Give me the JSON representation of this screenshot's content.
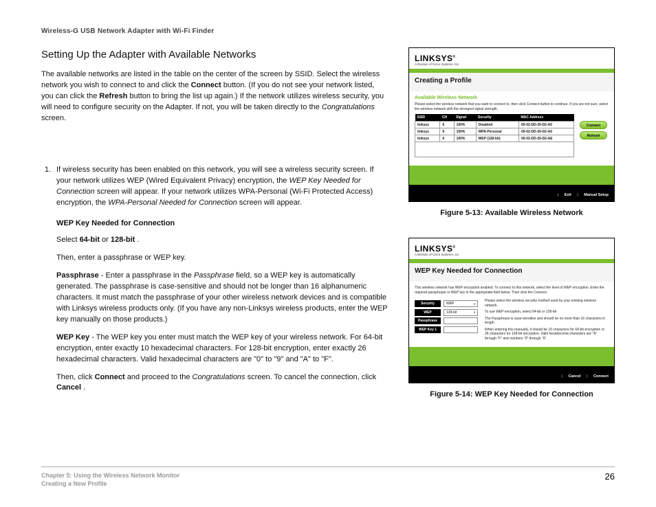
{
  "header": "Wireless-G USB Network Adapter with Wi-Fi Finder",
  "title": "Setting Up the Adapter with Available Networks",
  "intro": {
    "seg1": "The available networks are listed in the table on the center of the screen by SSID. Select the wireless network you wish to connect to and click the ",
    "btn_connect": "Connect",
    "seg2": " button. (If you do not see your network listed, you can click the ",
    "btn_refresh": "Refresh",
    "seg3": " button to bring the list up again.) If the network utilizes wireless security, you will need to configure security on the Adapter. If not, you will be taken directly to the ",
    "ital_congrats": "Congratulations",
    "seg4": " screen."
  },
  "li1": {
    "num": "1.",
    "a": "If wireless security has been enabled on this network, you will see a wireless security screen. If your network utilizes WEP (Wired Equivalent Privacy) encryption, the ",
    "b_ital": "WEP Key Needed for Connection",
    "c": " screen will appear. If your network utilizes WPA-Personal (Wi-Fi Protected Access) encryption, the ",
    "d_ital": "WPA-Personal Needed for Connection",
    "e": " screen will appear."
  },
  "wep_heading": "WEP Key Needed for Connection",
  "select_line": {
    "a": "Select ",
    "b64": "64-bit",
    "c": " or ",
    "b128": "128-bit",
    "d": "."
  },
  "then_enter": "Then, enter a passphrase or WEP key.",
  "passphrase": {
    "label": "Passphrase",
    "a": " - Enter a passphrase in the ",
    "field": "Passphrase",
    "b": " field, so a WEP key is automatically generated. The passphrase is case-sensitive and should not be longer than 16 alphanumeric characters. It must match the passphrase of your other wireless network devices and is compatible with Linksys wireless products only. (If you have any non-Linksys wireless products, enter the WEP key manually on those products.)"
  },
  "wepkey": {
    "label": "WEP Key",
    "a": " - The WEP key you enter must match the WEP key of your wireless network. For 64-bit encryption, enter exactly 10 hexadecimal characters. For 128-bit encryption, enter exactly 26 hexadecimal characters. Valid hexadecimal characters are \"0\" to \"9\" and \"A\" to \"F\"."
  },
  "closing": {
    "a": "Then, click ",
    "connect": "Connect",
    "b": " and proceed to the ",
    "congrats": "Congratulations",
    "c": " screen. To cancel the connection, click ",
    "cancel": "Cancel",
    "d": "."
  },
  "fig1": {
    "logo": "LINKSYS",
    "sub": "A Division of Cisco Systems, Inc.",
    "panel_title": "Creating a Profile",
    "section_title": "Available Wireless Network",
    "desc": "Please select the wireless network that you want to connect to, then click Connect button to continue. If you are not sure, select the wireless network with the strongest signal strength.",
    "th": {
      "ssid": "SSID",
      "ch": "CH",
      "signal": "Signal",
      "security": "Security",
      "mac": "MAC Address"
    },
    "rows": [
      {
        "ssid": "linksys",
        "ch": "6",
        "signal": "100%",
        "security": "Disabled",
        "mac": "00-02-DD-30-D2-A0"
      },
      {
        "ssid": "linksys",
        "ch": "6",
        "signal": "100%",
        "security": "WPA-Personal",
        "mac": "00-02-DD-30-D2-A0"
      },
      {
        "ssid": "linksys",
        "ch": "6",
        "signal": "100%",
        "security": "WEP (128-bit)",
        "mac": "00-02-DD-30-D2-AE"
      }
    ],
    "btn_connect": "Connect",
    "btn_refresh": "Refresh",
    "footer_exit": "Exit",
    "footer_manual": "Manual Setup",
    "caption": "Figure 5-13: Available Wireless Network"
  },
  "fig2": {
    "logo": "LINKSYS",
    "sub": "A Division of Cisco Systems, Inc.",
    "panel_title": "WEP Key Needed for Connection",
    "desc": "This wireless network has WEP encryption enabled. To connect to this network, select the level of WEP encryption. Enter the required passphrase or WEP key in the appropriate field below. Then click the Connect.",
    "labels": {
      "security": "Security",
      "wep": "WEP",
      "passphrase": "Passphrase",
      "wepkey1": "WEP Key 1"
    },
    "vals": {
      "security": "WEP",
      "wep": "128-bit"
    },
    "r1": "Please select the wireless security method used by your existing wireless network.",
    "r2": "To use WEP encryption, select 64-bit or 128-bit",
    "r3": "The Passphrase is case-sensitive and should be no more than 16 characters in length.",
    "r4": "When entering this manually, it should be 10 characters for 64-bit encryption or 26 characters for 128-bit encryption. Valid hexadecimal characters are \"A\" through \"F\" and numbers \"0\" through \"9\".",
    "footer_cancel": "Cancel",
    "footer_connect": "Connect",
    "caption": "Figure 5-14: WEP Key Needed for Connection"
  },
  "footer": {
    "chapter": "Chapter 5: Using the Wireless Network Monitor",
    "section": "Creating a New Profile",
    "pagenum": "26"
  }
}
